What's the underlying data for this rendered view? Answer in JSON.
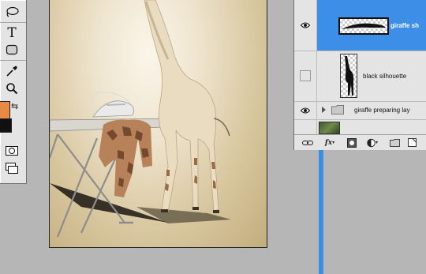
{
  "tools": {
    "items": [
      {
        "name": "lasso-tool"
      },
      {
        "name": "type-tool",
        "glyph": "T"
      },
      {
        "name": "rectangle-shape-tool"
      },
      {
        "name": "eyedropper-tool"
      },
      {
        "name": "zoom-tool"
      }
    ],
    "foreground_color": "#e88a43",
    "background_color": "#111111",
    "swap_glyph": "⇆"
  },
  "canvas": {
    "content": "giraffe ironing clothes photo manipulation"
  },
  "layers": {
    "rows": [
      {
        "name": "giraffe sh",
        "visible": true,
        "selected": true
      },
      {
        "name": "black silhouette",
        "visible": false,
        "selected": false
      },
      {
        "name": "giraffe preparing lay",
        "visible": true,
        "selected": false,
        "type": "group"
      },
      {
        "name": "",
        "visible": false,
        "selected": false,
        "type": "image"
      }
    ],
    "footer_icons": [
      "link-icon",
      "fx-icon",
      "add-mask-icon",
      "adjustment-layer-icon",
      "new-group-icon",
      "new-layer-icon",
      "trash-icon"
    ],
    "fx_label": "fx"
  },
  "colors": {
    "selection_blue": "#3d8ee6",
    "panel_gray": "#e4e4e4",
    "workspace_gray": "#b6b6b6"
  }
}
